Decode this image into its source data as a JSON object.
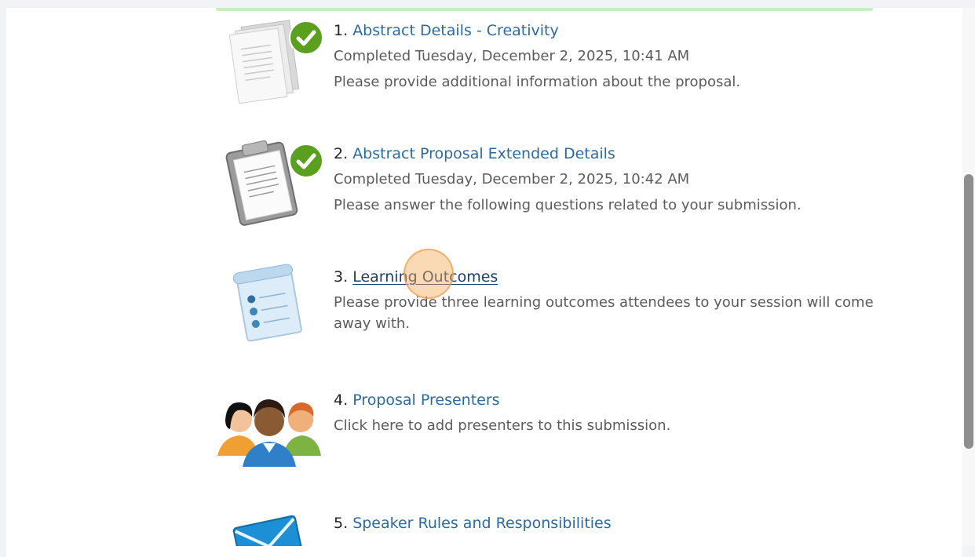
{
  "tasks": [
    {
      "number": "1.",
      "title": "Abstract Details - Creativity",
      "status": "Completed Tuesday, December 2, 2025, 10:41 AM",
      "description": "Please provide additional information about the proposal.",
      "icon": "documents-icon",
      "completed": true
    },
    {
      "number": "2.",
      "title": "Abstract Proposal Extended Details",
      "status": "Completed Tuesday, December 2, 2025, 10:42 AM",
      "description": "Please answer the following questions related to your submission.",
      "icon": "clipboard-icon",
      "completed": true
    },
    {
      "number": "3.",
      "title": "Learning Outcomes",
      "description": "Please provide three learning outcomes attendees to your session will come away with.",
      "icon": "scroll-list-icon",
      "completed": false
    },
    {
      "number": "4.",
      "title": "Proposal Presenters",
      "description": "Click here to add presenters to this submission.",
      "icon": "people-group-icon",
      "completed": false
    },
    {
      "number": "5.",
      "title": "Speaker Rules and Responsibilities",
      "icon": "envelope-icon",
      "completed": false
    }
  ],
  "colors": {
    "link": "#2b6aa1",
    "check": "#5aa01e",
    "cursor": "#f5aa5a"
  }
}
